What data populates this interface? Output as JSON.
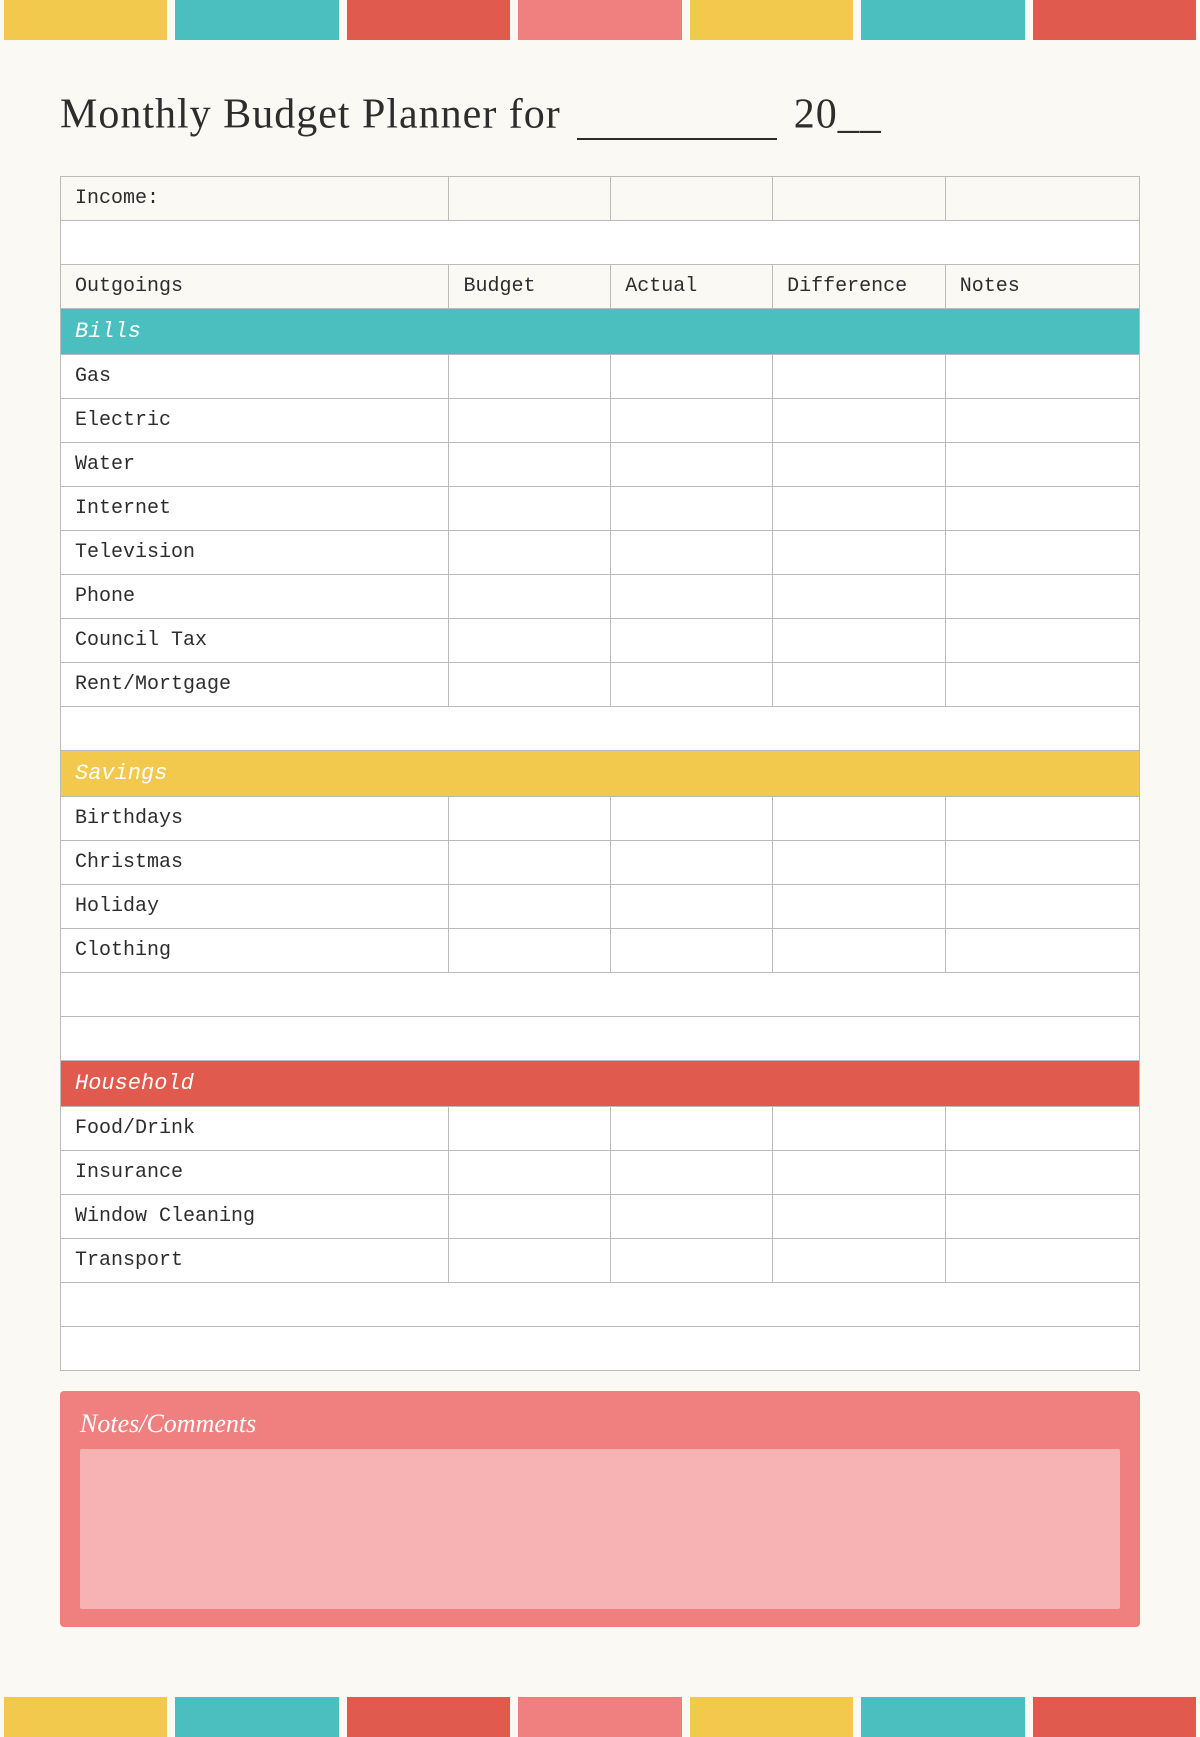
{
  "title": {
    "prefix": "Monthly Budget Planner for",
    "line_placeholder": "___________",
    "year_prefix": "20",
    "year_suffix": "__"
  },
  "color_bars": {
    "segments": [
      "yellow",
      "teal",
      "red",
      "pink",
      "yellow",
      "teal",
      "red"
    ]
  },
  "table": {
    "income_label": "Income:",
    "headers": {
      "outgoings": "Outgoings",
      "budget": "Budget",
      "actual": "Actual",
      "difference": "Difference",
      "notes": "Notes"
    },
    "sections": {
      "bills": {
        "label": "Bills",
        "rows": [
          "Gas",
          "Electric",
          "Water",
          "Internet",
          "Television",
          "Phone",
          "Council Tax",
          "Rent/Mortgage"
        ]
      },
      "savings": {
        "label": "Savings",
        "rows": [
          "Birthdays",
          "Christmas",
          "Holiday",
          "Clothing"
        ]
      },
      "household": {
        "label": "Household",
        "rows": [
          "Food/Drink",
          "Insurance",
          "Window Cleaning",
          "Transport"
        ]
      }
    }
  },
  "notes_section": {
    "label": "Notes/Comments"
  }
}
